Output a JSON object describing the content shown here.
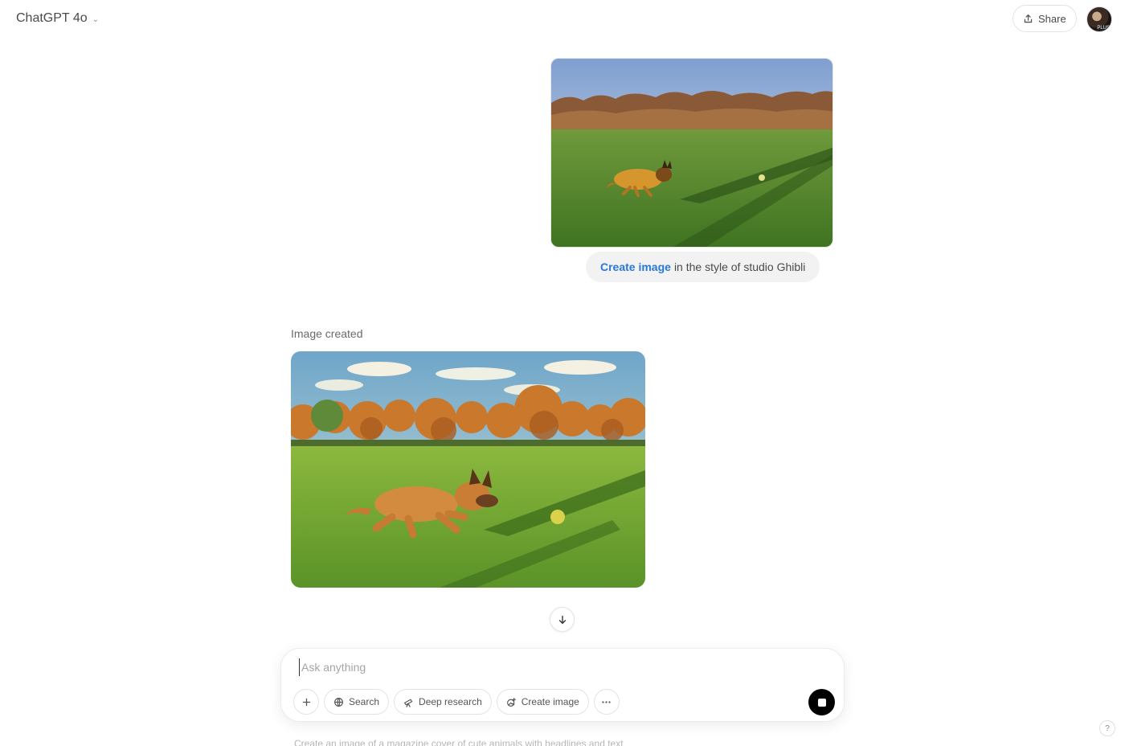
{
  "header": {
    "model_label": "ChatGPT 4o",
    "share_label": "Share",
    "avatar_tag": "PLUS"
  },
  "conversation": {
    "user_message": {
      "link_text": "Create image",
      "text": "in the style of studio Ghibli",
      "attachment_alt": "Photo of a dog running on a grass field chasing a ball"
    },
    "assistant_message": {
      "status": "Image created",
      "image_alt": "Studio Ghibli style illustration of a dog running on a grass field chasing a ball"
    }
  },
  "composer": {
    "placeholder": "Ask anything",
    "tools": [
      {
        "label": "Search",
        "icon": "globe-icon"
      },
      {
        "label": "Deep research",
        "icon": "telescope-icon"
      },
      {
        "label": "Create image",
        "icon": "image-icon"
      }
    ]
  },
  "footer": {
    "suggestion": "Create an image of a magazine cover of cute animals with headlines and text",
    "help_label": "?"
  },
  "colors": {
    "link": "#2a78d6",
    "bubble_bg": "#f2f2f2",
    "stop_button": "#000000"
  }
}
